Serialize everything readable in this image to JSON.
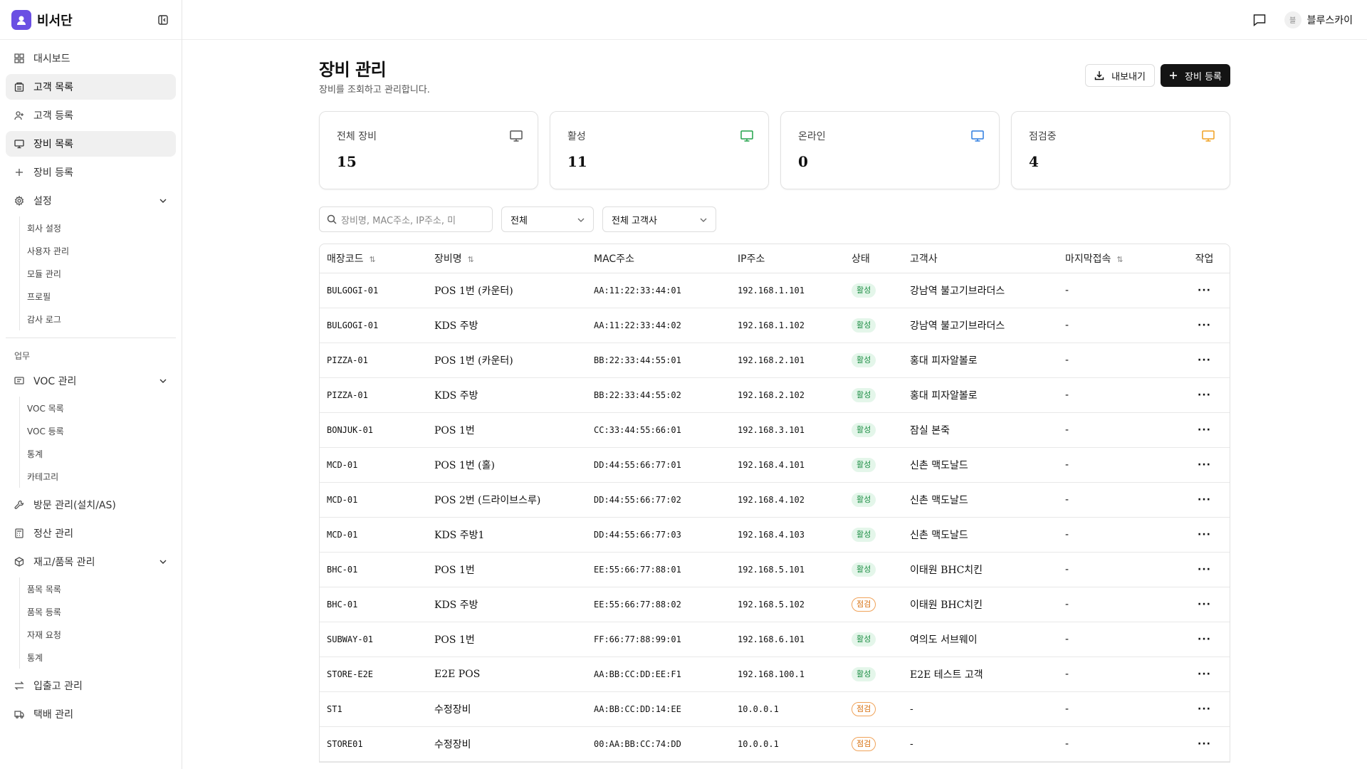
{
  "app": {
    "name": "비서단"
  },
  "sidebar": {
    "items_top": [
      {
        "label": "대시보드",
        "icon": "dashboard-icon",
        "active": false
      },
      {
        "label": "고객 목록",
        "icon": "building-icon",
        "active": true
      },
      {
        "label": "고객 등록",
        "icon": "user-plus-icon",
        "active": false
      },
      {
        "label": "장비 목록",
        "icon": "monitor-icon",
        "active": true
      },
      {
        "label": "장비 등록",
        "icon": "plus-icon",
        "active": false
      }
    ],
    "settings": {
      "label": "설정",
      "sub": [
        "회사 설정",
        "사용자 관리",
        "모듈 관리",
        "프로필",
        "감사 로그"
      ]
    },
    "group_label": "업무",
    "voc": {
      "label": "VOC 관리",
      "sub": [
        "VOC 목록",
        "VOC 등록",
        "통계",
        "카테고리"
      ]
    },
    "visit": {
      "label": "방문 관리(설치/AS)"
    },
    "settle": {
      "label": "정산 관리"
    },
    "inventory": {
      "label": "재고/품목 관리",
      "sub": [
        "품목 목록",
        "품목 등록",
        "자재 요청",
        "통계"
      ]
    },
    "inout": {
      "label": "입출고 관리"
    },
    "delivery": {
      "label": "택배 관리"
    }
  },
  "topbar": {
    "user_initial": "블",
    "user_name": "블루스카이"
  },
  "page": {
    "title": "장비 관리",
    "subtitle": "장비를 조회하고 관리합니다.",
    "export_label": "내보내기",
    "register_label": "장비 등록"
  },
  "stats": [
    {
      "label": "전체 장비",
      "value": "15",
      "color": "#555555"
    },
    {
      "label": "활성",
      "value": "11",
      "color": "#22a34a"
    },
    {
      "label": "온라인",
      "value": "0",
      "color": "#2f7de1"
    },
    {
      "label": "점검중",
      "value": "4",
      "color": "#f0a020"
    }
  ],
  "filters": {
    "search_placeholder": "장비명, MAC주소, IP주소, 미",
    "status_value": "전체",
    "customer_value": "전체 고객사"
  },
  "table": {
    "headers": [
      "매장코드",
      "장비명",
      "MAC주소",
      "IP주소",
      "상태",
      "고객사",
      "마지막접속",
      "작업"
    ],
    "rows": [
      [
        "BULGOGI-01",
        "POS 1번 (카운터)",
        "AA:11:22:33:44:01",
        "192.168.1.101",
        "활성",
        "강남역 불고기브라더스",
        "-"
      ],
      [
        "BULGOGI-01",
        "KDS 주방",
        "AA:11:22:33:44:02",
        "192.168.1.102",
        "활성",
        "강남역 불고기브라더스",
        "-"
      ],
      [
        "PIZZA-01",
        "POS 1번 (카운터)",
        "BB:22:33:44:55:01",
        "192.168.2.101",
        "활성",
        "홍대 피자알볼로",
        "-"
      ],
      [
        "PIZZA-01",
        "KDS 주방",
        "BB:22:33:44:55:02",
        "192.168.2.102",
        "활성",
        "홍대 피자알볼로",
        "-"
      ],
      [
        "BONJUK-01",
        "POS 1번",
        "CC:33:44:55:66:01",
        "192.168.3.101",
        "활성",
        "잠실 본죽",
        "-"
      ],
      [
        "MCD-01",
        "POS 1번 (홀)",
        "DD:44:55:66:77:01",
        "192.168.4.101",
        "활성",
        "신촌 맥도날드",
        "-"
      ],
      [
        "MCD-01",
        "POS 2번 (드라이브스루)",
        "DD:44:55:66:77:02",
        "192.168.4.102",
        "활성",
        "신촌 맥도날드",
        "-"
      ],
      [
        "MCD-01",
        "KDS 주방1",
        "DD:44:55:66:77:03",
        "192.168.4.103",
        "활성",
        "신촌 맥도날드",
        "-"
      ],
      [
        "BHC-01",
        "POS 1번",
        "EE:55:66:77:88:01",
        "192.168.5.101",
        "활성",
        "이태원 BHC치킨",
        "-"
      ],
      [
        "BHC-01",
        "KDS 주방",
        "EE:55:66:77:88:02",
        "192.168.5.102",
        "점검",
        "이태원 BHC치킨",
        "-"
      ],
      [
        "SUBWAY-01",
        "POS 1번",
        "FF:66:77:88:99:01",
        "192.168.6.101",
        "활성",
        "여의도 서브웨이",
        "-"
      ],
      [
        "STORE-E2E",
        "E2E POS",
        "AA:BB:CC:DD:EE:F1",
        "192.168.100.1",
        "활성",
        "E2E 테스트 고객",
        "-"
      ],
      [
        "ST1",
        "수정장비",
        "AA:BB:CC:DD:14:EE",
        "10.0.0.1",
        "점검",
        "-",
        "-"
      ],
      [
        "STORE01",
        "수정장비",
        "00:AA:BB:CC:74:DD",
        "10.0.0.1",
        "점검",
        "-",
        "-"
      ]
    ]
  }
}
